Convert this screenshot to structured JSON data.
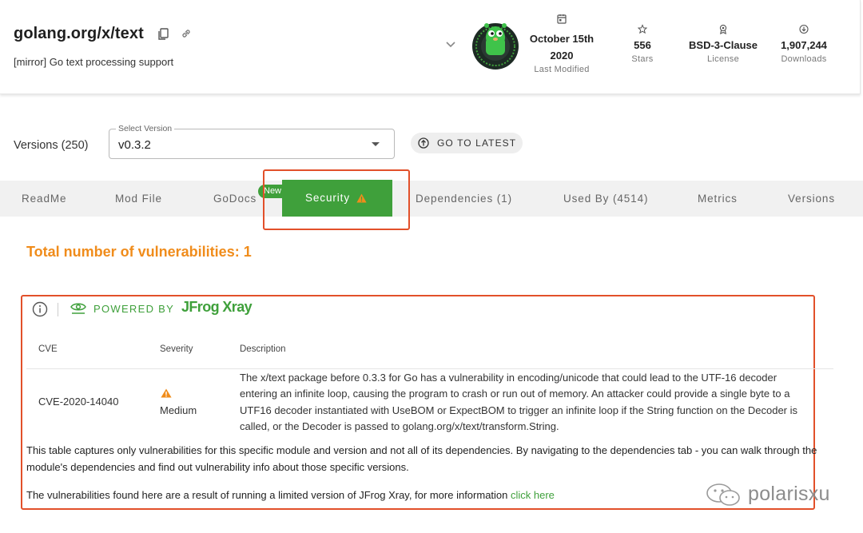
{
  "header": {
    "title": "golang.org/x/text",
    "subtitle": "[mirror] Go text processing support",
    "last_modified": {
      "value_line1": "October 15th",
      "value_line2": "2020",
      "label": "Last Modified"
    },
    "stars": {
      "value": "556",
      "label": "Stars"
    },
    "license": {
      "value": "BSD-3-Clause",
      "label": "License"
    },
    "downloads": {
      "value": "1,907,244",
      "label": "Downloads"
    },
    "icons": {
      "copy": "copy-icon",
      "link": "link-icon",
      "expand": "chevron-down-icon",
      "calendar": "calendar-icon",
      "star": "star-icon",
      "license": "ribbon-icon",
      "download": "download-icon"
    }
  },
  "versions": {
    "label": "Versions (250)",
    "select_legend": "Select Version",
    "selected": "v0.3.2",
    "go_latest_label": "GO TO LATEST"
  },
  "tabs": {
    "new_badge": "New",
    "items": [
      {
        "label": "ReadMe"
      },
      {
        "label": "Mod File"
      },
      {
        "label": "GoDocs"
      },
      {
        "label": "Security",
        "active": true
      },
      {
        "label": "Dependencies (1)"
      },
      {
        "label": "Used By (4514)"
      },
      {
        "label": "Metrics"
      },
      {
        "label": "Versions"
      }
    ]
  },
  "security": {
    "vuln_count_text": "Total number of vulnerabilities: 1",
    "powered_by": "POWERED BY",
    "xray_logo": "JFrog Xray",
    "columns": {
      "cve": "CVE",
      "severity": "Severity",
      "description": "Description"
    },
    "rows": [
      {
        "cve": "CVE-2020-14040",
        "severity": "Medium",
        "description": "The x/text package before 0.3.3 for Go has a vulnerability in encoding/unicode that could lead to the UTF-16 decoder entering an infinite loop, causing the program to crash or run out of memory. An attacker could provide a single byte to a UTF16 decoder instantiated with UseBOM or ExpectBOM to trigger an infinite loop if the String function on the Decoder is called, or the Decoder is passed to golang.org/x/text/transform.String."
      }
    ],
    "note_scope": "This table captures only vulnerabilities for this specific module and version and not all of its dependencies. By navigating to the dependencies tab - you can walk through the module's dependencies and find out vulnerability info about those specific versions.",
    "note_limited": "The vulnerabilities found here are a result of running a limited version of JFrog Xray, for more information ",
    "click_here": "click here"
  },
  "watermark": {
    "text": "polarisxu"
  },
  "colors": {
    "accent_green": "#3fa03b",
    "warning_orange": "#f08c1b",
    "annotation_red": "#e2502a"
  }
}
